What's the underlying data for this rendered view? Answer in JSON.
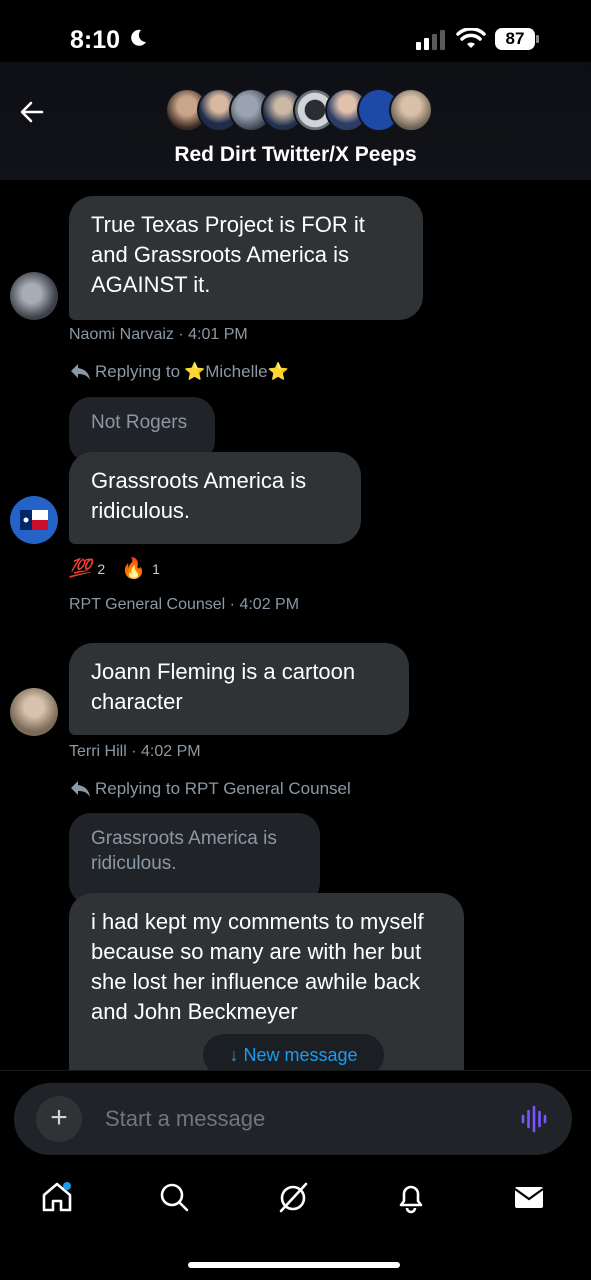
{
  "status": {
    "time": "8:10",
    "battery": "87"
  },
  "header": {
    "group_name": "Red Dirt Twitter/X Peeps"
  },
  "messages": {
    "m1": {
      "text": "True Texas Project is FOR it and Grassroots America is AGAINST it.",
      "author_time": "Naomi Narvaiz · 4:01 PM"
    },
    "m2": {
      "replying_label": "Replying to",
      "replying_to": "⭐Michelle⭐",
      "quote": "Not Rogers",
      "text": "Grassroots America is ridiculous.",
      "reactions": [
        {
          "emoji": "💯",
          "count": "2"
        },
        {
          "emoji": "🔥",
          "count": "1"
        }
      ],
      "author_time": "RPT General Counsel · 4:02 PM"
    },
    "m3": {
      "text": "Joann Fleming is a cartoon character",
      "author_time": "Terri Hill · 4:02 PM"
    },
    "m4": {
      "replying_line": "Replying to RPT General Counsel",
      "quote": "Grassroots America is ridiculous.",
      "text": "i had kept my comments to myself because so many are with her but she lost her influence awhile back and John Beckmeyer"
    }
  },
  "new_message": {
    "label": "↓ New message"
  },
  "composer": {
    "placeholder": "Start a message",
    "plus": "+"
  },
  "tabs": [
    "home-icon",
    "search-icon",
    "grok-icon",
    "notifications-icon",
    "messages-icon"
  ],
  "colors": {
    "accent": "#1d9bf0",
    "bubble": "#2f3336",
    "voice": "#7856ff"
  }
}
